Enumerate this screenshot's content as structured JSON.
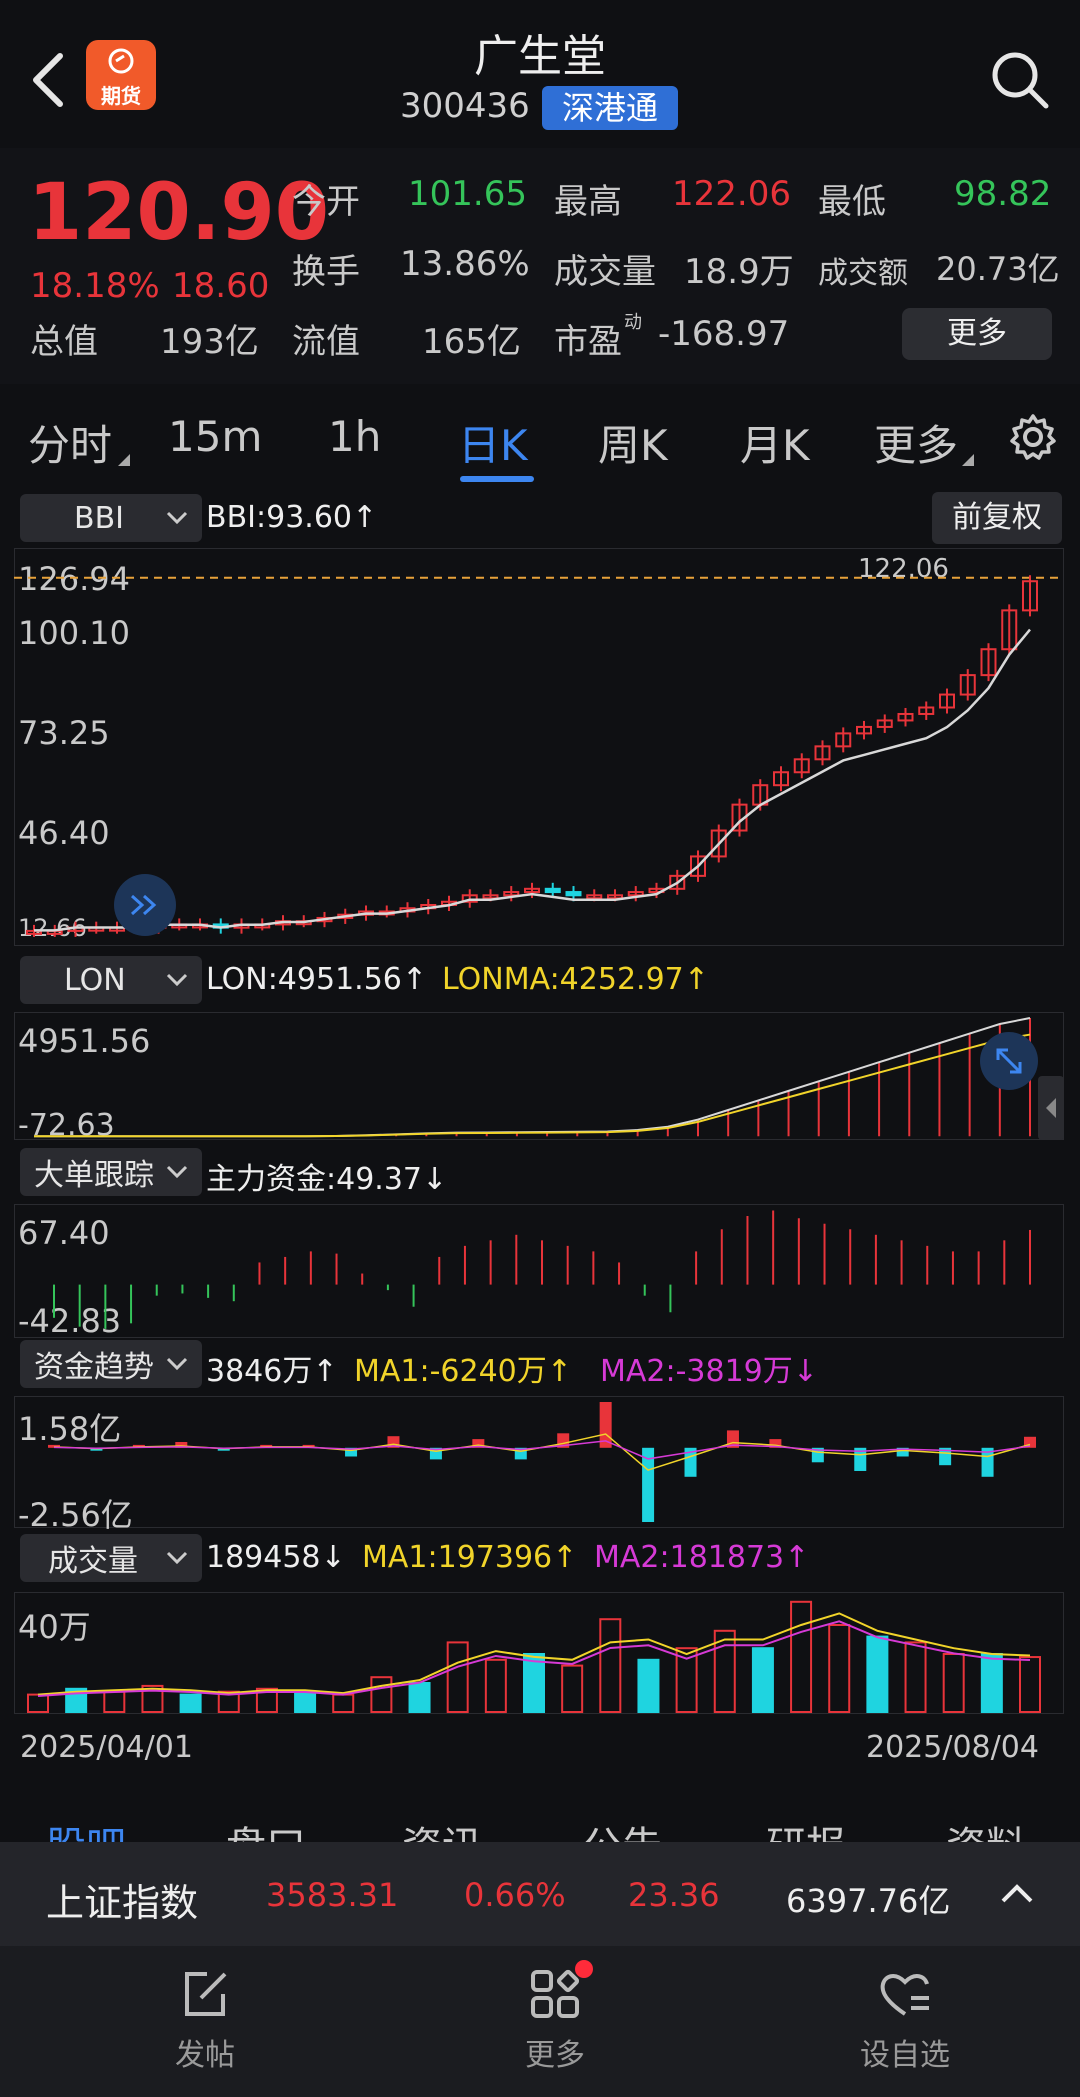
{
  "header": {
    "stock_name": "广生堂",
    "stock_code": "300436",
    "badge": "深港通",
    "futures_badge": "期货"
  },
  "quote": {
    "price": "120.90",
    "change_pct": "18.18%",
    "change": "18.60",
    "open_label": "今开",
    "open": "101.65",
    "high_label": "最高",
    "high": "122.06",
    "low_label": "最低",
    "low": "98.82",
    "turnover_label": "换手",
    "turnover": "13.86%",
    "volume_label": "成交量",
    "volume": "18.9万",
    "amount_label": "成交额",
    "amount": "20.73亿",
    "mktcap_label": "总值",
    "mktcap": "193亿",
    "float_label": "流值",
    "float": "165亿",
    "pe_label": "市盈",
    "pe_sup": "动",
    "pe": "-168.97",
    "more_button": "更多"
  },
  "tabs": [
    "分时",
    "15m",
    "1h",
    "日K",
    "周K",
    "月K",
    "更多"
  ],
  "active_tab": "日K",
  "main_chart": {
    "indicator": "BBI",
    "readout": "BBI:93.60↑",
    "adjust_button": "前复权",
    "y_labels": [
      "126.94",
      "100.10",
      "73.25",
      "46.40",
      "12.66"
    ],
    "max_marker": "122.06"
  },
  "lon_panel": {
    "indicator": "LON",
    "lon": "LON:4951.56↑",
    "lonma": "LONMA:4252.97↑",
    "y_top": "4951.56",
    "y_bottom": "-72.63"
  },
  "bigorder_panel": {
    "indicator": "大单跟踪",
    "readout": "主力资金:49.37↓",
    "y_top": "67.40",
    "y_bottom": "-42.83"
  },
  "fund_panel": {
    "indicator": "资金趋势",
    "value": "3846万↑",
    "ma1": "MA1:-6240万↑",
    "ma2": "MA2:-3819万↓",
    "y_top": "1.58亿",
    "y_bottom": "-2.56亿"
  },
  "volume_panel": {
    "indicator": "成交量",
    "value": "189458↓",
    "ma1": "MA1:197396↑",
    "ma2": "MA2:181873↑",
    "y_top": "40万"
  },
  "dates": {
    "start": "2025/04/01",
    "end": "2025/08/04"
  },
  "section_tabs": [
    "股吧",
    "盘口",
    "资讯",
    "公告",
    "研报",
    "资料"
  ],
  "index_bar": {
    "name": "上证指数",
    "value": "3583.31",
    "pct": "0.66%",
    "change": "23.36",
    "amount": "6397.76亿"
  },
  "bottom_nav": {
    "post": "发帖",
    "more": "更多",
    "watch": "设自选"
  },
  "colors": {
    "up": "#e8343a",
    "down": "#1fd4e0",
    "accent": "#2f6fd6",
    "badge": "#2f6fd6",
    "ma1": "#f1d42a",
    "ma2": "#d63ad6"
  },
  "chart_data": [
    {
      "type": "candlestick",
      "title": "BBI",
      "ylim": [
        12.66,
        126.94
      ],
      "series": [
        {
          "name": "close (approx)",
          "values": [
            13,
            13,
            14,
            14,
            14,
            14,
            15,
            15,
            15,
            14,
            15,
            15,
            16,
            16,
            17,
            18,
            19,
            19,
            20,
            21,
            22,
            24,
            24,
            25,
            26,
            25,
            24,
            24,
            24,
            25,
            26,
            30,
            36,
            44,
            52,
            58,
            62,
            66,
            70,
            74,
            76,
            78,
            80,
            82,
            86,
            92,
            100,
            112,
            121
          ]
        }
      ]
    },
    {
      "type": "bar",
      "title": "LON",
      "ylim": [
        -72.63,
        4951.56
      ],
      "series": [
        {
          "name": "LON",
          "values": [
            0,
            0,
            0,
            0,
            0,
            0,
            0,
            0,
            0,
            0,
            10,
            40,
            80,
            120,
            150,
            160,
            170,
            180,
            190,
            200,
            260,
            400,
            700,
            1100,
            1500,
            1900,
            2300,
            2700,
            3100,
            3500,
            3900,
            4300,
            4700,
            4951.56
          ]
        }
      ]
    },
    {
      "type": "bar",
      "title": "大单跟踪",
      "ylim": [
        -42.83,
        67.4
      ],
      "series": [
        {
          "name": "主力资金",
          "values": [
            -30,
            -38,
            -40,
            -35,
            -10,
            -8,
            -12,
            -15,
            20,
            25,
            30,
            28,
            10,
            -5,
            -20,
            25,
            35,
            40,
            45,
            40,
            35,
            30,
            20,
            -10,
            -25,
            30,
            50,
            62,
            67,
            60,
            55,
            50,
            45,
            40,
            35,
            30,
            30,
            40,
            49.37
          ]
        }
      ]
    },
    {
      "type": "bar",
      "title": "资金趋势",
      "ylim": [
        -2.56,
        1.58
      ],
      "series": [
        {
          "name": "资金趋势",
          "values": [
            0.1,
            -0.1,
            0.1,
            0.2,
            -0.1,
            0.1,
            0.1,
            -0.3,
            0.4,
            -0.4,
            0.3,
            -0.4,
            0.5,
            1.58,
            -2.56,
            -1.0,
            0.6,
            0.3,
            -0.5,
            -0.8,
            -0.3,
            -0.6,
            -1.0,
            0.38
          ]
        }
      ]
    },
    {
      "type": "bar",
      "title": "成交量",
      "ylim": [
        0,
        400000
      ],
      "series": [
        {
          "name": "volume",
          "values": [
            60000,
            80000,
            70000,
            90000,
            60000,
            70000,
            80000,
            70000,
            60000,
            120000,
            100000,
            240000,
            180000,
            200000,
            160000,
            320000,
            180000,
            220000,
            280000,
            220000,
            380000,
            300000,
            260000,
            240000,
            200000,
            200000,
            189458
          ]
        }
      ]
    }
  ]
}
